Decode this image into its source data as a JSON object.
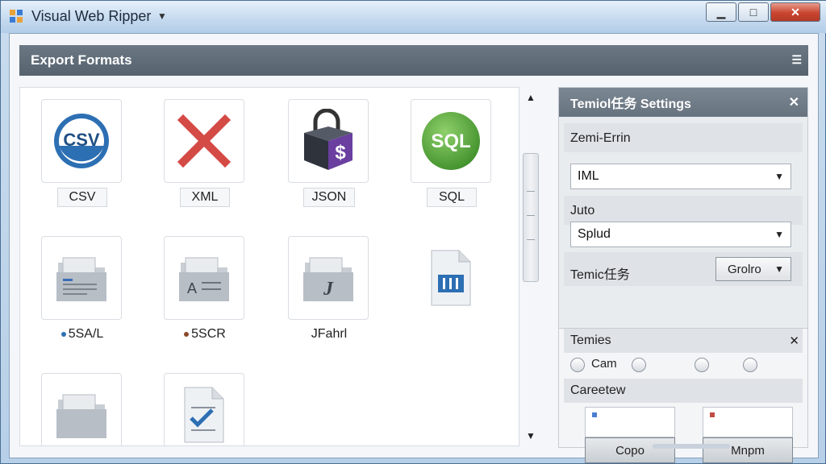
{
  "window": {
    "title": "Visual Web Ripper",
    "controls": {
      "minimize": "▁",
      "maximize": "□",
      "close": "✕"
    }
  },
  "export_panel": {
    "title": "Export Formats",
    "menu_glyph": "☰",
    "formats": [
      {
        "label": "CSV",
        "icon": "csv-icon",
        "badge_text": "CSV"
      },
      {
        "label": "XML",
        "icon": "red-x-icon"
      },
      {
        "label": "JSON",
        "icon": "package-icon",
        "badge_text": "$"
      },
      {
        "label": "SQL",
        "icon": "sql-icon",
        "badge_text": "SQL"
      },
      {
        "label": "5SA/L",
        "icon": "folder-icon"
      },
      {
        "label": "5SCR",
        "icon": "folder-text-icon",
        "badge_text": "A"
      },
      {
        "label": "JFahrl",
        "icon": "folder-j-icon",
        "badge_text": "J"
      },
      {
        "label": "",
        "icon": "document-blue-icon"
      },
      {
        "label": "",
        "icon": "folder-icon"
      },
      {
        "label": "",
        "icon": "document-check-icon"
      }
    ]
  },
  "settings_panel": {
    "title": "Temiol任务 Settings",
    "close": "✕",
    "field1": {
      "label": "Zemi-Errin",
      "value": "IML"
    },
    "field2": {
      "label": "Juto",
      "value": "Splud"
    },
    "field3": {
      "label": "Temic任务",
      "value": "Grolro"
    },
    "sub": {
      "title": "Temies",
      "close": "✕",
      "radio_first_label": "Cam",
      "section_label": "Careetew",
      "buttons": [
        "Copo",
        "Mnpm"
      ]
    }
  },
  "colors": {
    "csv_blue": "#2d6fb3",
    "x_red": "#d44a45",
    "sql_green": "#57a83c",
    "json_purple": "#6a3fa0"
  }
}
